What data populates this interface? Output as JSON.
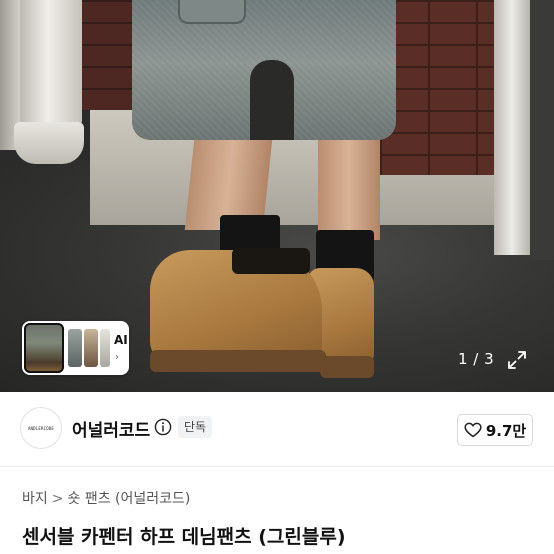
{
  "gallery": {
    "thumbnail_strip": {
      "ai_label": "AI",
      "ai_chevron": "›"
    },
    "pager": "1 / 3",
    "expand_icon": "expand-icon"
  },
  "seller": {
    "avatar_text": "ANDLERCODE",
    "name": "어널러코드",
    "info_icon": "info-icon",
    "badge": "단독",
    "like": {
      "icon": "heart-outline-icon",
      "count": "9.7만"
    }
  },
  "breadcrumb": {
    "items": [
      "바지",
      "숏 팬츠 (어널러코드)"
    ],
    "separator": ">"
  },
  "product": {
    "title": "센서블 카펜터 하프 데님팬츠 (그린블루)"
  }
}
